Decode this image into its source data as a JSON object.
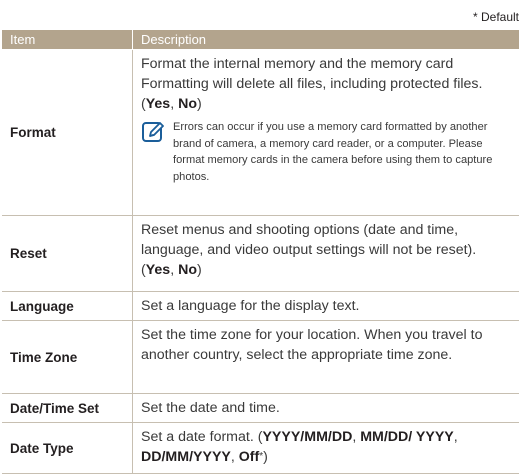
{
  "default_note": "* Default",
  "header": {
    "item": "Item",
    "description": "Description"
  },
  "rows": [
    {
      "item": "Format",
      "desc_main": "Format the internal memory and the memory card Formatting will delete all files, including protected files. (",
      "opt1": "Yes",
      "sep1": ", ",
      "opt2": "No",
      "close": ")",
      "note_icon": "note-pencil-icon",
      "note": "Errors can occur if you use a memory card formatted by another brand of camera, a memory card reader, or a computer. Please format memory cards in the camera before using them to capture photos."
    },
    {
      "item": "Reset",
      "desc_main": "Reset menus and shooting options (date and time, language, and video output settings will not be reset). (",
      "opt1": "Yes",
      "sep1": ", ",
      "opt2": "No",
      "close": ")"
    },
    {
      "item": "Language",
      "desc": "Set a language for the display text."
    },
    {
      "item": "Time Zone",
      "desc": "Set the time zone for your location. When you travel to another country, select the appropriate time zone."
    },
    {
      "item": "Date/Time Set",
      "desc": "Set the date and time."
    },
    {
      "item": "Date Type",
      "desc_main": "Set a date format. (",
      "opt1": "YYYY/MM/DD",
      "sep1": ", ",
      "opt2": "MM/DD/ YYYY",
      "sep2": ", ",
      "opt3": "DD/MM/YYYY",
      "sep3": ", ",
      "opt4": "Off",
      "star": "*",
      "close": ")"
    }
  ],
  "colors": {
    "header_bg": "#b3a48d",
    "rule": "#c7bfb1",
    "icon": "#1b5e9a"
  }
}
